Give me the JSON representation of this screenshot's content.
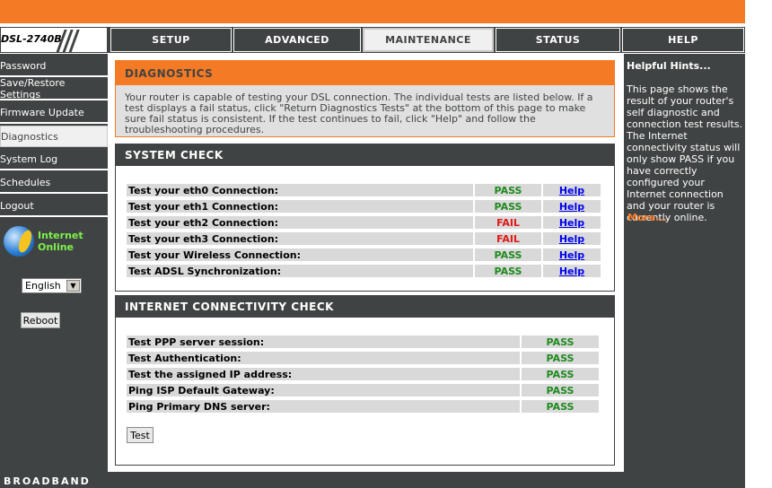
{
  "brand": {
    "model": "DSL-2740B"
  },
  "nav": {
    "tabs": [
      {
        "label": "SETUP"
      },
      {
        "label": "ADVANCED"
      },
      {
        "label": "MAINTENANCE"
      },
      {
        "label": "STATUS"
      },
      {
        "label": "HELP"
      }
    ],
    "active_tab": "MAINTENANCE"
  },
  "sidebar": {
    "items": [
      {
        "label": "Password"
      },
      {
        "label": "Save/Restore Settings"
      },
      {
        "label": "Firmware Update"
      },
      {
        "label": "Diagnostics"
      },
      {
        "label": "System Log"
      },
      {
        "label": "Schedules"
      },
      {
        "label": "Logout"
      }
    ],
    "active_item": "Diagnostics",
    "internet_status_line1": "Internet",
    "internet_status_line2": "Online",
    "language": "English",
    "reboot_label": "Reboot"
  },
  "diagnostics": {
    "title": "DIAGNOSTICS",
    "description": "Your router is capable of testing your DSL connection. The individual tests are listed below. If a test displays a fail status, click \"Return Diagnostics Tests\" at the bottom of this page to make sure fail status is consistent. If the test continues to fail, click \"Help\" and follow the troubleshooting procedures."
  },
  "system_check": {
    "title": "SYSTEM CHECK",
    "rows": [
      {
        "label": "Test your eth0 Connection:",
        "result": "PASS",
        "help": "Help"
      },
      {
        "label": "Test your eth1 Connection:",
        "result": "PASS",
        "help": "Help"
      },
      {
        "label": "Test your eth2 Connection:",
        "result": "FAIL",
        "help": "Help"
      },
      {
        "label": "Test your eth3 Connection:",
        "result": "FAIL",
        "help": "Help"
      },
      {
        "label": "Test your Wireless Connection:",
        "result": "PASS",
        "help": "Help"
      },
      {
        "label": "Test ADSL Synchronization:",
        "result": "PASS",
        "help": "Help"
      }
    ]
  },
  "internet_check": {
    "title": "INTERNET CONNECTIVITY CHECK",
    "rows": [
      {
        "label": "Test PPP server session:",
        "result": "PASS"
      },
      {
        "label": "Test Authentication:",
        "result": "PASS"
      },
      {
        "label": "Test the assigned IP address:",
        "result": "PASS"
      },
      {
        "label": "Ping ISP Default Gateway:",
        "result": "PASS"
      },
      {
        "label": "Ping Primary DNS server:",
        "result": "PASS"
      }
    ],
    "test_label": "Test"
  },
  "hints": {
    "title": "Helpful Hints...",
    "text": "This page shows the result of your router's self diagnostic and connection test results. The Internet connectivity status will only show PASS if you have correctly configured your Internet connection and your router is currently online.",
    "more_label": "More..."
  },
  "footer": {
    "text": "BROADBAND"
  },
  "colors": {
    "accent_orange": "#f47a25",
    "dark_gray": "#404343",
    "pass_green": "#1e8a1e",
    "fail_red": "#e01818",
    "link_blue": "#0000ee"
  }
}
